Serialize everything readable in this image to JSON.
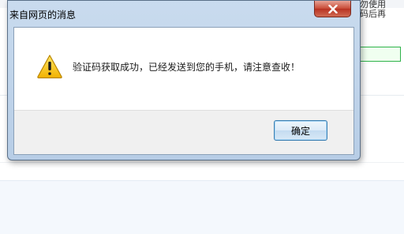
{
  "background_page": {
    "side_text_line1": "勿使用",
    "side_text_line2": "码后再"
  },
  "dialog": {
    "title": "来自网页的消息",
    "close_icon": "close-x-icon",
    "warning_icon": "warning-triangle-icon",
    "message": "验证码获取成功，已经发送到您的手机，请注意查收！",
    "ok_label": "确定"
  },
  "colors": {
    "close_button": "#c74a35",
    "warning_yellow": "#f5c400",
    "input_border": "#2fb24a",
    "ok_button_border": "#3c7fb1"
  }
}
